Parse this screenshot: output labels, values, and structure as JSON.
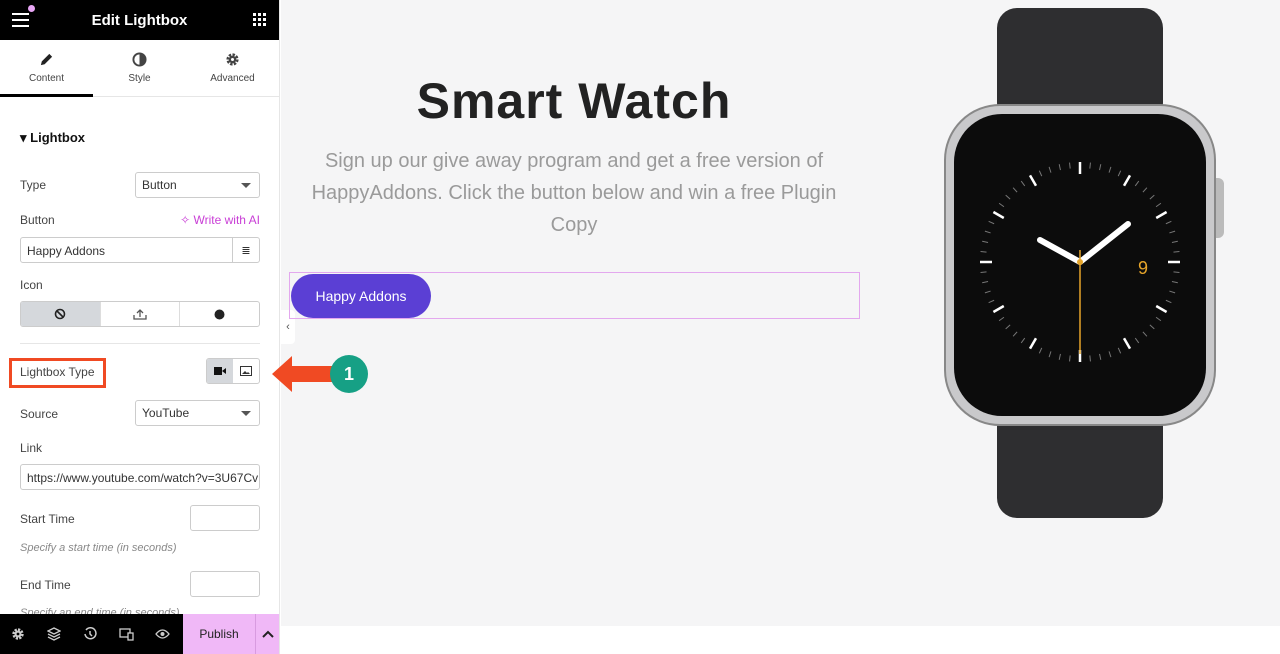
{
  "panel": {
    "title": "Edit Lightbox",
    "tabs": [
      {
        "label": "Content",
        "icon": "pencil-icon",
        "active": true
      },
      {
        "label": "Style",
        "icon": "half-circle-icon"
      },
      {
        "label": "Advanced",
        "icon": "gear-icon"
      }
    ],
    "section": "Lightbox",
    "type": {
      "label": "Type",
      "value": "Button"
    },
    "button": {
      "label": "Button",
      "ai": "Write with AI",
      "value": "Happy Addons"
    },
    "icon": {
      "label": "Icon",
      "options": [
        "none-icon",
        "upload-icon",
        "circle-icon"
      ],
      "selected": 0
    },
    "lightbox_type": {
      "label": "Lightbox Type",
      "options": [
        "video-icon",
        "image-icon"
      ],
      "selected": 0
    },
    "source": {
      "label": "Source",
      "value": "YouTube"
    },
    "link": {
      "label": "Link",
      "value": "https://www.youtube.com/watch?v=3U67Cv"
    },
    "start": {
      "label": "Start Time",
      "hint": "Specify a start time (in seconds)",
      "value": ""
    },
    "end": {
      "label": "End Time",
      "hint": "Specify an end time (in seconds)",
      "value": ""
    },
    "publish": "Publish"
  },
  "canvas": {
    "title": "Smart Watch",
    "description": "Sign up our give away program and get a free version of HappyAddons. Click the button below and win a free Plugin Copy",
    "button": "Happy Addons",
    "watch_number": "9"
  },
  "annotation": {
    "step": "1",
    "color": "#f04a23",
    "badge_color": "#16a085"
  },
  "colors": {
    "accent": "#5b3fd4",
    "publish": "#f0b8f7",
    "ai": "#c93fd6"
  }
}
